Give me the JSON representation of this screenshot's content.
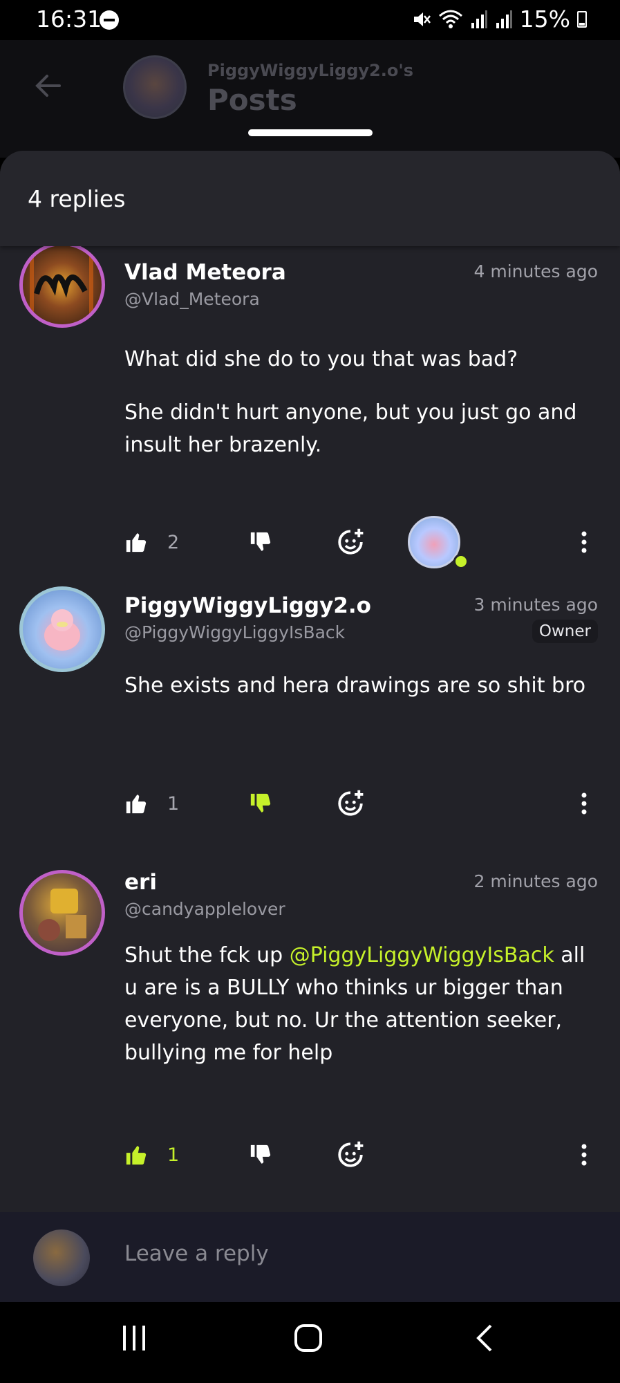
{
  "status": {
    "time": "16:31",
    "battery": "15%",
    "icons": [
      "dnd-icon",
      "mute-icon",
      "wifi-icon",
      "signal-icon",
      "signal-icon",
      "battery-icon"
    ]
  },
  "header": {
    "subtitle": "PiggyWiggyLiggy2.o's",
    "title": "Posts"
  },
  "sheet": {
    "replies_count": "4 replies"
  },
  "comments": [
    {
      "name": "Vlad Meteora",
      "handle": "@Vlad_Meteora",
      "time": "4 minutes ago",
      "paragraphs": [
        "What did she do to you that was bad?",
        "She didn't hurt anyone, but you just go and insult her brazenly."
      ],
      "likes": "2",
      "liked": false,
      "disliked": false
    },
    {
      "name": "PiggyWiggyLiggy2.o",
      "handle": "@PiggyWiggyLiggyIsBack",
      "time": "3 minutes ago",
      "badge": "Owner",
      "text": "She exists and hera drawings are so shit bro",
      "likes": "1",
      "liked": false,
      "disliked": true
    },
    {
      "name": "eri",
      "handle": "@candyapplelover",
      "time": "2 minutes ago",
      "mention": "@PiggyLiggyWiggyIsBack",
      "text_before": "Shut the fck up ",
      "text_after": " all u are is a BULLY who thinks ur bigger than everyone, but no. Ur the attention seeker, bullying me for help",
      "likes": "1",
      "liked": true,
      "disliked": false
    }
  ],
  "reply_bar": {
    "placeholder": "Leave a reply"
  },
  "colors": {
    "accent": "#c6f12a",
    "sheet": "#222228",
    "header": "#26262c",
    "reply_bar": "#1b1b28"
  }
}
